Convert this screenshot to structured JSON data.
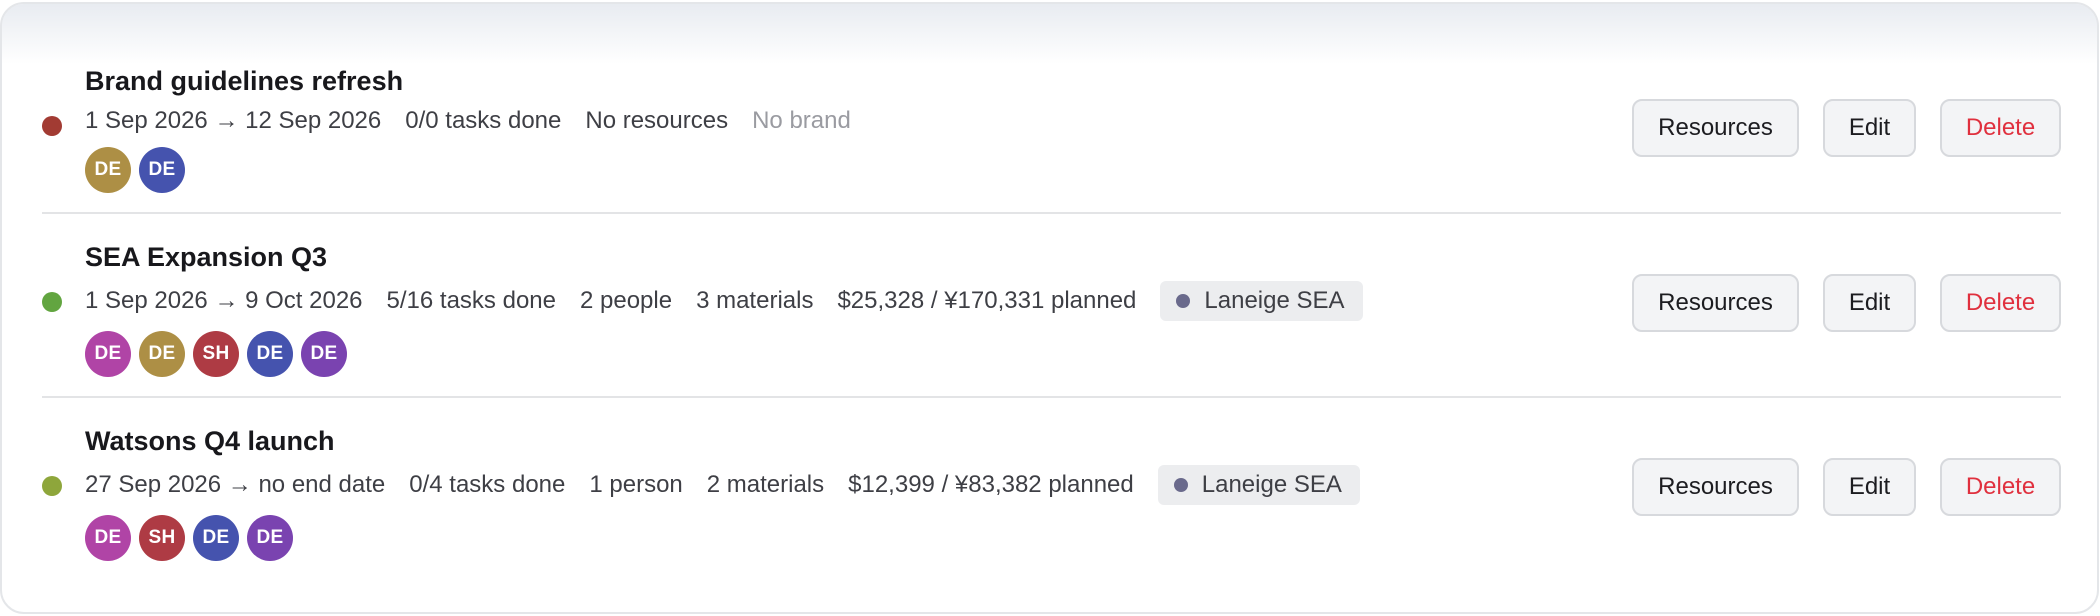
{
  "projects": [
    {
      "title": "Brand guidelines refresh",
      "status_color": "#a23b33",
      "dates": "1 Sep 2026 → 12 Sep 2026",
      "tasks": "0/0 tasks done",
      "people": "No resources",
      "materials": "",
      "budget": "",
      "brand_text": "No brand",
      "brand": null,
      "members": [
        {
          "initials": "DE",
          "color": "#ad8f45"
        },
        {
          "initials": "DE",
          "color": "#4553ae"
        }
      ],
      "actions": {
        "resources": "Resources",
        "edit": "Edit",
        "delete": "Delete"
      }
    },
    {
      "title": "SEA Expansion Q3",
      "status_color": "#62a540",
      "dates": "1 Sep 2026 → 9 Oct 2026",
      "tasks": "5/16 tasks done",
      "people": "2 people",
      "materials": "3 materials",
      "budget": "$25,328 / ¥170,331 planned",
      "brand_text": "",
      "brand": {
        "name": "Laneige SEA",
        "color": "#6a6a8c"
      },
      "members": [
        {
          "initials": "DE",
          "color": "#b044a6"
        },
        {
          "initials": "DE",
          "color": "#ad8f45"
        },
        {
          "initials": "SH",
          "color": "#ae3b44"
        },
        {
          "initials": "DE",
          "color": "#4553ae"
        },
        {
          "initials": "DE",
          "color": "#7a43b0"
        }
      ],
      "actions": {
        "resources": "Resources",
        "edit": "Edit",
        "delete": "Delete"
      }
    },
    {
      "title": "Watsons Q4 launch",
      "status_color": "#8ea63b",
      "dates": "27 Sep 2026 → no end date",
      "tasks": "0/4 tasks done",
      "people": "1 person",
      "materials": "2 materials",
      "budget": "$12,399 / ¥83,382 planned",
      "brand_text": "",
      "brand": {
        "name": "Laneige SEA",
        "color": "#6a6a8c"
      },
      "members": [
        {
          "initials": "DE",
          "color": "#b044a6"
        },
        {
          "initials": "SH",
          "color": "#ae3b44"
        },
        {
          "initials": "DE",
          "color": "#4553ae"
        },
        {
          "initials": "DE",
          "color": "#7a43b0"
        }
      ],
      "actions": {
        "resources": "Resources",
        "edit": "Edit",
        "delete": "Delete"
      }
    }
  ]
}
